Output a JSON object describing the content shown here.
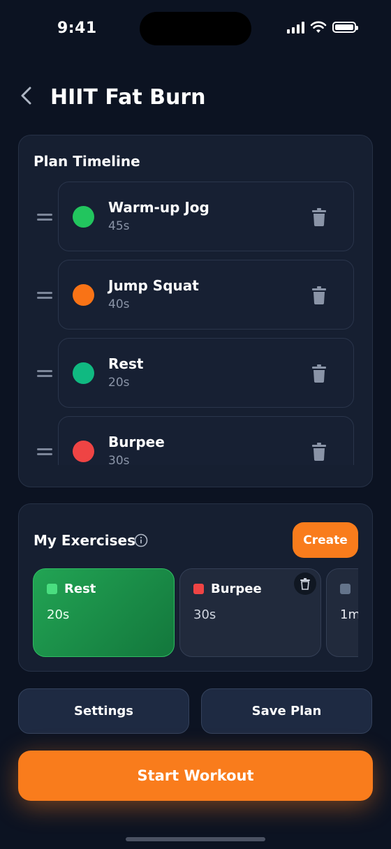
{
  "status_bar": {
    "time": "9:41"
  },
  "header": {
    "title": "HIIT Fat Burn"
  },
  "timeline": {
    "title": "Plan Timeline",
    "items": [
      {
        "name": "Warm-up Jog",
        "duration": "45s",
        "color": "#22c55e"
      },
      {
        "name": "Jump Squat",
        "duration": "40s",
        "color": "#f97316"
      },
      {
        "name": "Rest",
        "duration": "20s",
        "color": "#10b981"
      },
      {
        "name": "Burpee",
        "duration": "30s",
        "color": "#ef4444"
      }
    ]
  },
  "exercises": {
    "title": "My Exercises",
    "create_label": "Create",
    "tiles": [
      {
        "name": "Rest",
        "duration": "20s",
        "color": "#4ade80"
      },
      {
        "name": "Burpee",
        "duration": "30s",
        "color": "#ef4444"
      },
      {
        "name": "",
        "duration": "1m",
        "color": "#64748b"
      }
    ]
  },
  "actions": {
    "settings_label": "Settings",
    "save_label": "Save Plan",
    "start_label": "Start Workout"
  },
  "colors": {
    "accent": "#f97c1c",
    "background": "#0c1322",
    "card": "#161f31"
  }
}
